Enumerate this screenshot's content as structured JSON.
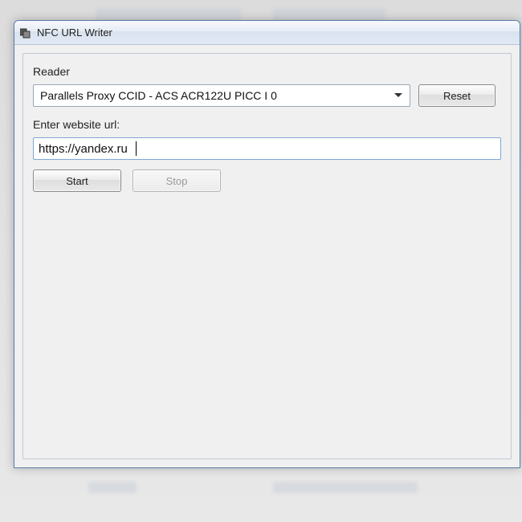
{
  "window": {
    "title": "NFC URL Writer"
  },
  "reader": {
    "label": "Reader",
    "selected": "Parallels Proxy CCID - ACS ACR122U PICC I 0",
    "reset_label": "Reset"
  },
  "url": {
    "label": "Enter website url:",
    "value": "https://yandex.ru"
  },
  "buttons": {
    "start": "Start",
    "stop": "Stop"
  }
}
